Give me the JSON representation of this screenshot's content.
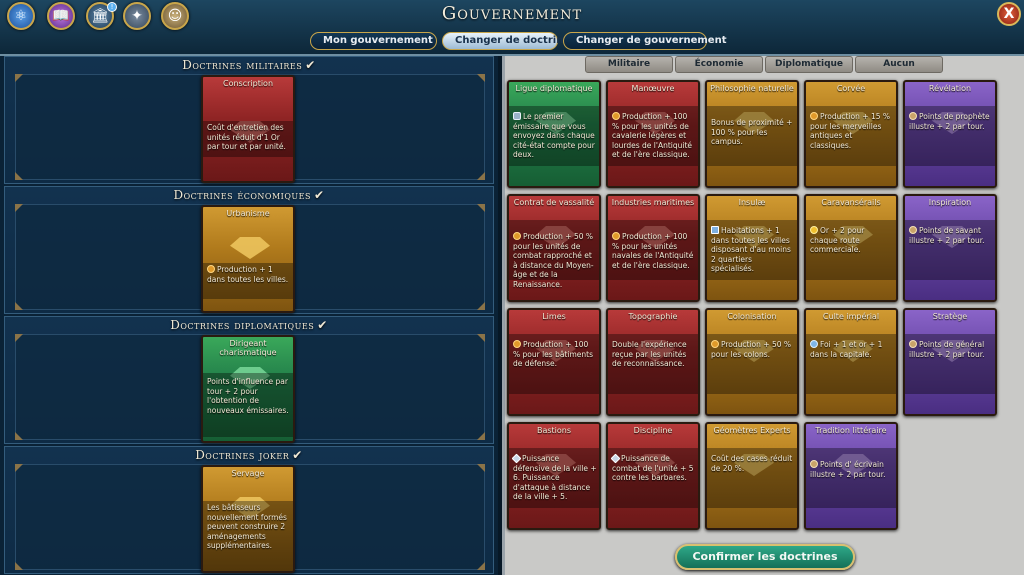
{
  "header": {
    "title": "Gouvernement",
    "close_label": "X",
    "notification_badge": "!",
    "tabs": [
      "Mon gouvernement",
      "Changer de doctrines",
      "Changer de gouvernement"
    ],
    "active_tab": 1
  },
  "slots": [
    {
      "title": "Doctrines militaires",
      "card": {
        "name": "Conscription",
        "color": "red",
        "body": "Coût d'entretien des unités réduit d'1 Or par tour et par unité."
      }
    },
    {
      "title": "Doctrines économiques",
      "card": {
        "name": "Urbanisme",
        "color": "gold",
        "body": "Production + 1 dans toutes les villes."
      }
    },
    {
      "title": "Doctrines diplomatiques",
      "card": {
        "name": "Dirigeant charismatique",
        "color": "green",
        "body": "Points d'influence par tour + 2 pour l'obtention de nouveaux émissaires."
      }
    },
    {
      "title": "Doctrines joker",
      "card": {
        "name": "Servage",
        "color": "gold",
        "body": "Les bâtisseurs nouvellement formés peuvent construire 2 aménagements supplémentaires."
      }
    }
  ],
  "filters": [
    "Militaire",
    "Économie",
    "Diplomatique",
    "Aucun"
  ],
  "policies": [
    {
      "name": "Ligue diplomatique",
      "color": "green",
      "body": "Le premier émissaire que vous envoyez dans chaque cité-état compte pour deux."
    },
    {
      "name": "Manœuvre",
      "color": "red",
      "body": "Production + 100 % pour les unités de cavalerie légères et lourdes de l'Antiquité et de l'ère classique."
    },
    {
      "name": "Philosophie naturelle",
      "color": "gold",
      "body": "Bonus de proximité + 100 % pour les campus."
    },
    {
      "name": "Corvée",
      "color": "gold",
      "body": "Production + 15 % pour les merveilles antiques et classiques."
    },
    {
      "name": "Révélation",
      "color": "purple",
      "body": "Points de prophète illustre + 2 par tour."
    },
    {
      "name": "Contrat de vassalité",
      "color": "red",
      "body": "Production + 50 % pour les unités de combat rapproché et à distance du Moyen-âge et de la Renaissance."
    },
    {
      "name": "Industries maritimes",
      "color": "red",
      "body": "Production + 100 % pour les unités navales de l'Antiquité et de l'ère classique."
    },
    {
      "name": "Insulæ",
      "color": "gold",
      "body": "Habitations + 1 dans toutes les villes disposant d'au moins 2 quartiers spécialisés."
    },
    {
      "name": "Caravansérails",
      "color": "gold",
      "body": "Or + 2 pour chaque route commerciale."
    },
    {
      "name": "Inspiration",
      "color": "purple",
      "body": "Points de savant illustre + 2 par tour."
    },
    {
      "name": "Limes",
      "color": "red",
      "body": "Production + 100 % pour les bâtiments de défense."
    },
    {
      "name": "Topographie",
      "color": "red",
      "body": "Double l'expérience reçue par les unités de reconnaissance."
    },
    {
      "name": "Colonisation",
      "color": "gold",
      "body": "Production + 50 % pour les colons."
    },
    {
      "name": "Culte impérial",
      "color": "gold",
      "body": "Foi + 1 et or + 1 dans la capitale."
    },
    {
      "name": "Stratège",
      "color": "purple",
      "body": "Points de général illustre + 2 par tour."
    },
    {
      "name": "Bastions",
      "color": "red",
      "body": "Puissance défensive de la ville + 6. Puissance d'attaque à distance de la ville + 5."
    },
    {
      "name": "Discipline",
      "color": "red",
      "body": "Puissance de combat de l'unité + 5 contre les barbares."
    },
    {
      "name": "Géomètres Experts",
      "color": "gold",
      "body": "Coût des cases réduit de 20 %."
    },
    {
      "name": "Tradition littéraire",
      "color": "purple",
      "body": "Points d' écrivain illustre + 2 par tour."
    }
  ],
  "confirm_label": "Confirmer les doctrines",
  "colors": {
    "red": "#8f2424",
    "gold": "#b07a1c",
    "green": "#23804a",
    "purple": "#6a48a8"
  }
}
